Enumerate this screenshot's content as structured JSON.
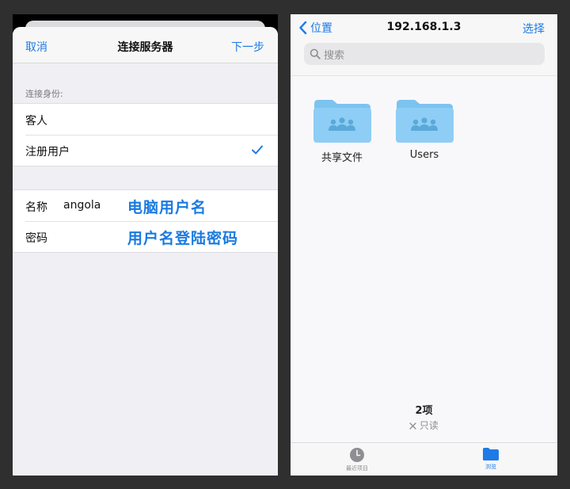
{
  "connect_sheet": {
    "cancel": "取消",
    "title": "连接服务器",
    "next": "下一步",
    "section_label": "连接身份:",
    "identity_options": [
      {
        "label": "客人",
        "selected": false
      },
      {
        "label": "注册用户",
        "selected": true
      }
    ],
    "name_label": "名称",
    "name_value": "angola",
    "name_annotation": "电脑用户名",
    "password_label": "密码",
    "password_annotation": "用户名登陆密码"
  },
  "browser": {
    "back_label": "位置",
    "title": "192.168.1.3",
    "select": "选择",
    "search_placeholder": "搜索",
    "folders": [
      {
        "name": "共享文件",
        "icon": "shared-folder-icon"
      },
      {
        "name": "Users",
        "icon": "shared-folder-icon"
      }
    ],
    "items_count": "2项",
    "read_only": "只读",
    "tabs": [
      {
        "label": "最近项目",
        "icon": "clock-icon",
        "active": false
      },
      {
        "label": "浏览",
        "icon": "folder-icon",
        "active": true
      }
    ]
  },
  "colors": {
    "accent": "#1e7ae6",
    "annotation": "#1a7ae0",
    "folder": "#8ecdf5"
  }
}
